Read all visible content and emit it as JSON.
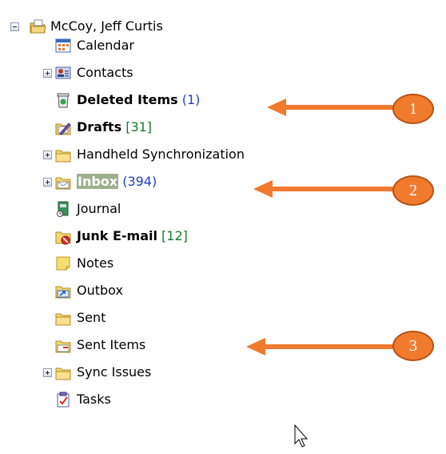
{
  "tree": {
    "root": {
      "label": "McCoy, Jeff Curtis",
      "expander": "minus",
      "icon": "mailbox-folder-icon"
    },
    "items": [
      {
        "key": "calendar",
        "label": "Calendar",
        "icon": "calendar-icon",
        "bold": false
      },
      {
        "key": "contacts",
        "label": "Contacts",
        "icon": "contacts-icon",
        "bold": false,
        "expander": "plus"
      },
      {
        "key": "deleted",
        "label": "Deleted Items",
        "count": "(1)",
        "count_style": "blue",
        "icon": "deleted-items-icon",
        "bold": true
      },
      {
        "key": "drafts",
        "label": "Drafts",
        "count": "[31]",
        "count_style": "green",
        "icon": "drafts-icon",
        "bold": true
      },
      {
        "key": "handheld",
        "label": "Handheld Synchronization",
        "icon": "folder-icon",
        "bold": false,
        "expander": "plus"
      },
      {
        "key": "inbox",
        "label": "Inbox",
        "count": "(394)",
        "count_style": "blue",
        "icon": "inbox-icon",
        "bold": true,
        "expander": "plus",
        "selected": true
      },
      {
        "key": "journal",
        "label": "Journal",
        "icon": "journal-icon",
        "bold": false
      },
      {
        "key": "junk",
        "label": "Junk E-mail",
        "count": "[12]",
        "count_style": "green",
        "icon": "junk-email-icon",
        "bold": true
      },
      {
        "key": "notes",
        "label": "Notes",
        "icon": "notes-icon",
        "bold": false
      },
      {
        "key": "outbox",
        "label": "Outbox",
        "icon": "outbox-icon",
        "bold": false
      },
      {
        "key": "sent",
        "label": "Sent",
        "icon": "folder-icon",
        "bold": false
      },
      {
        "key": "sentitems",
        "label": "Sent Items",
        "icon": "sent-items-icon",
        "bold": false
      },
      {
        "key": "syncissues",
        "label": "Sync Issues",
        "icon": "folder-icon",
        "bold": false,
        "expander": "plus"
      },
      {
        "key": "tasks",
        "label": "Tasks",
        "icon": "tasks-icon",
        "bold": false
      }
    ]
  },
  "callouts": [
    {
      "number": "1",
      "points_to": "Deleted Items"
    },
    {
      "number": "2",
      "points_to": "Inbox"
    },
    {
      "number": "3",
      "points_to": "Sent Items"
    }
  ],
  "colors": {
    "callout_orange": "#f07a2e",
    "count_blue": "#1f3fc2",
    "count_green": "#177a2e",
    "inbox_highlight": "#9db08c"
  },
  "cursor": {
    "icon": "mouse-pointer-icon"
  }
}
